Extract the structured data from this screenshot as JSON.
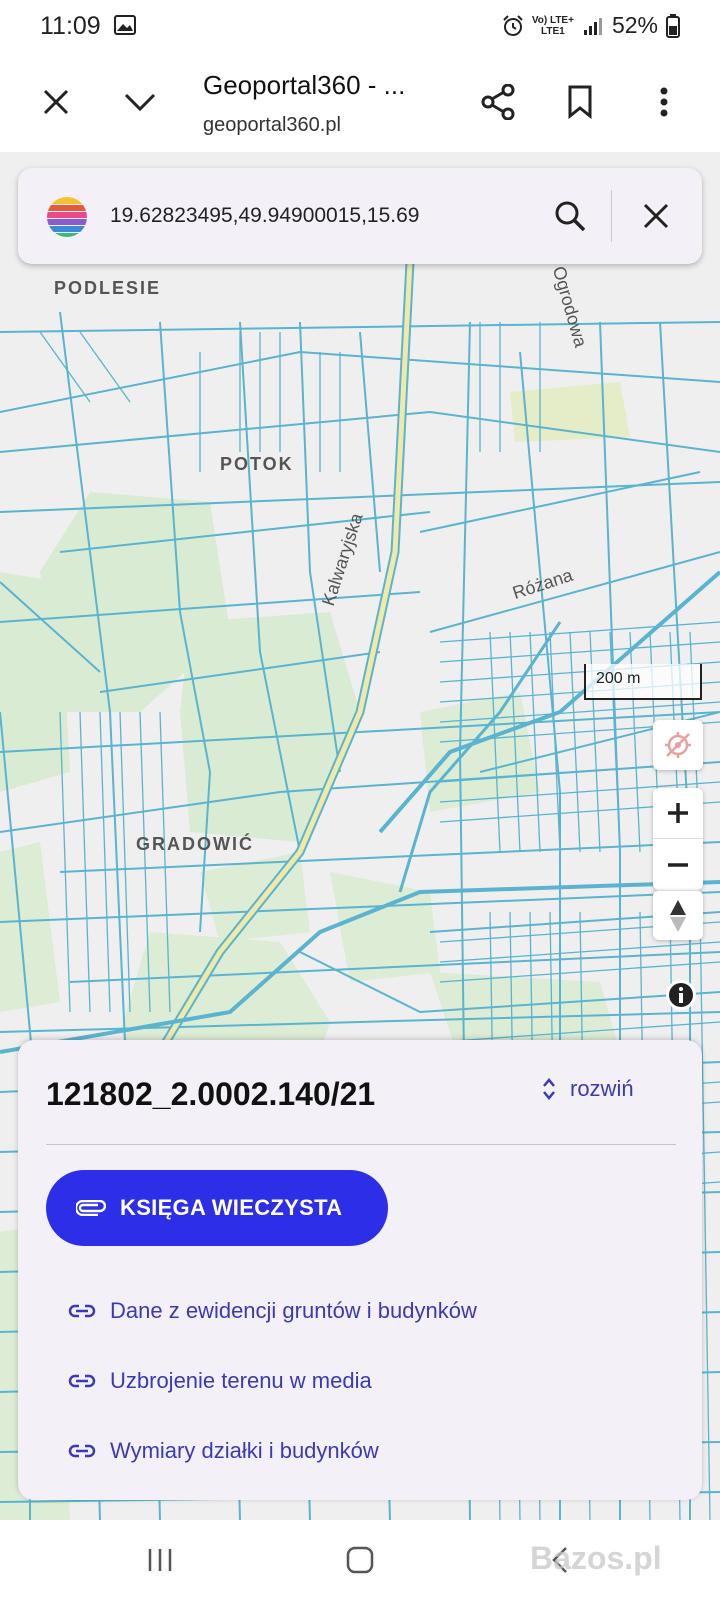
{
  "status_bar": {
    "time": "11:09",
    "network_line1": "Vo) LTE+",
    "network_line2": "LTE1",
    "battery": "52%"
  },
  "toolbar": {
    "title": "Geoportal360 - ...",
    "url": "geoportal360.pl"
  },
  "search": {
    "value": "19.62823495,49.94900015,15.69"
  },
  "map": {
    "labels": {
      "podlesie": "PODLESIE",
      "potok": "POTOK",
      "gradowic": "GRADOWIĆ"
    },
    "streets": {
      "kalwaryjska": "Kalwaryjska",
      "ogrodowa": "Ogrodowa",
      "rozana": "Różana"
    },
    "scale": "200 m",
    "colors": {
      "parcel_line": "#5ab4cf",
      "green_area": "#d7ebd0",
      "road": "#f1e9a8",
      "selected_parcel": "#2f7dd8"
    }
  },
  "panel": {
    "parcel_id": "121802_2.0002.140/21",
    "expand_label": "rozwiń",
    "kw_button": "KSIĘGA WIECZYSTA",
    "links": [
      "Dane z ewidencji gruntów i budynków",
      "Uzbrojenie terenu w media",
      "Wymiary działki i budynków"
    ],
    "accent_color": "#2d2fe8"
  },
  "watermark": "Bazos.pl"
}
